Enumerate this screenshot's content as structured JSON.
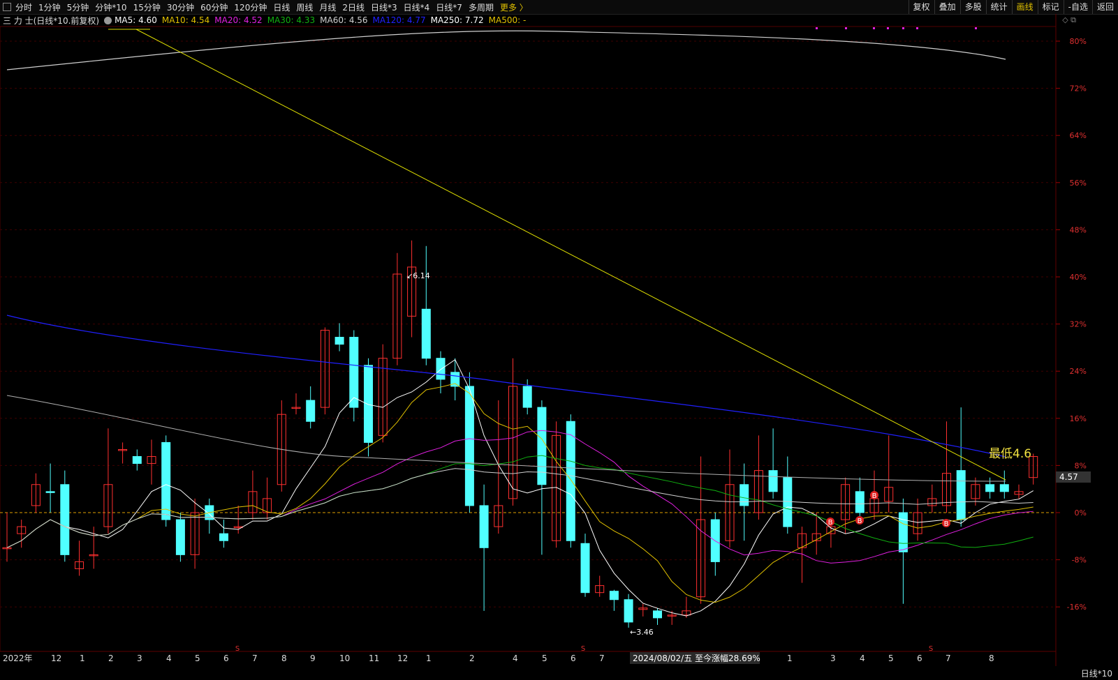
{
  "toolbar": {
    "periods": [
      "分时",
      "1分钟",
      "5分钟",
      "分钟*10",
      "15分钟",
      "30分钟",
      "60分钟",
      "120分钟",
      "日线",
      "周线",
      "月线",
      "2日线",
      "日线*3",
      "日线*4",
      "日线*7",
      "多周期"
    ],
    "more_label": "更多 〉",
    "right_tools": [
      "复权",
      "叠加",
      "多股",
      "统计",
      "画线",
      "标记",
      "-自选",
      "返回"
    ],
    "active_tool": "画线"
  },
  "legend": {
    "stock": "三 力 士(日线*10.前复权)",
    "ma": [
      {
        "label": "MA5: 4.60",
        "color": "#ffffff"
      },
      {
        "label": "MA10: 4.54",
        "color": "#e0c000"
      },
      {
        "label": "MA20: 4.52",
        "color": "#e020e0"
      },
      {
        "label": "MA30: 4.33",
        "color": "#10b010"
      },
      {
        "label": "MA60: 4.56",
        "color": "#d0d0d0"
      },
      {
        "label": "MA120: 4.77",
        "color": "#2020ff"
      },
      {
        "label": "MA250: 7.72",
        "color": "#ffffff"
      },
      {
        "label": "MA500: -",
        "color": "#e0c000"
      }
    ]
  },
  "chart_data": {
    "type": "candlestick",
    "pct_axis": {
      "ticks": [
        "80%",
        "72%",
        "64%",
        "56%",
        "48%",
        "40%",
        "32%",
        "24%",
        "16%",
        "8%",
        "0%",
        "-8%",
        "-16%"
      ]
    },
    "x_labels": [
      "2022年",
      "12",
      "1",
      "2",
      "3",
      "4",
      "5",
      "6",
      "7",
      "8",
      "9",
      "10",
      "11",
      "12",
      "1",
      "2",
      "4",
      "5",
      "6",
      "7",
      "8",
      "1",
      "3",
      "4",
      "5",
      "6",
      "7",
      "8"
    ],
    "candles": [
      [
        3.95,
        4.2,
        3.95,
        3.85,
        "up"
      ],
      [
        4.1,
        4.15,
        4.05,
        3.95,
        "up"
      ],
      [
        4.4,
        4.48,
        4.25,
        4.2,
        "up"
      ],
      [
        4.35,
        4.55,
        4.35,
        4.2,
        "dn"
      ],
      [
        4.4,
        4.5,
        3.9,
        3.85,
        "dn"
      ],
      [
        3.8,
        4.0,
        3.85,
        3.75,
        "up"
      ],
      [
        3.9,
        4.1,
        3.9,
        3.8,
        "up"
      ],
      [
        4.4,
        4.8,
        4.1,
        4.05,
        "up"
      ],
      [
        4.65,
        4.7,
        4.65,
        4.55,
        "up"
      ],
      [
        4.6,
        4.65,
        4.55,
        4.5,
        "dn"
      ],
      [
        4.6,
        4.72,
        4.55,
        4.4,
        "up"
      ],
      [
        4.7,
        4.75,
        4.15,
        4.1,
        "dn"
      ],
      [
        4.15,
        4.2,
        3.9,
        3.85,
        "dn"
      ],
      [
        3.9,
        4.3,
        4.2,
        3.8,
        "up"
      ],
      [
        4.25,
        4.3,
        4.15,
        4.05,
        "dn"
      ],
      [
        4.0,
        4.15,
        4.05,
        3.95,
        "dn"
      ],
      [
        4.1,
        4.25,
        4.1,
        4.05,
        "up"
      ],
      [
        4.35,
        4.5,
        4.2,
        4.15,
        "up"
      ],
      [
        4.3,
        4.45,
        4.2,
        4.15,
        "up"
      ],
      [
        4.9,
        5.0,
        4.4,
        4.35,
        "up"
      ],
      [
        4.95,
        5.05,
        4.95,
        4.9,
        "up"
      ],
      [
        5.0,
        5.1,
        4.85,
        4.8,
        "dn"
      ],
      [
        5.5,
        5.52,
        4.95,
        4.9,
        "up"
      ],
      [
        5.45,
        5.55,
        5.4,
        5.35,
        "dn"
      ],
      [
        5.45,
        5.5,
        4.95,
        4.85,
        "dn"
      ],
      [
        5.25,
        5.3,
        4.7,
        4.6,
        "dn"
      ],
      [
        5.3,
        5.4,
        4.75,
        4.7,
        "up"
      ],
      [
        5.9,
        6.05,
        5.3,
        5.25,
        "up"
      ],
      [
        5.95,
        6.14,
        5.6,
        5.45,
        "up"
      ],
      [
        5.65,
        6.1,
        5.3,
        5.25,
        "dn"
      ],
      [
        5.3,
        5.35,
        5.15,
        5.05,
        "dn"
      ],
      [
        5.2,
        5.3,
        5.1,
        5.0,
        "dn"
      ],
      [
        5.1,
        5.2,
        4.25,
        4.2,
        "dn"
      ],
      [
        4.25,
        4.4,
        3.95,
        3.5,
        "dn"
      ],
      [
        4.1,
        5.0,
        4.25,
        4.05,
        "up"
      ],
      [
        5.1,
        5.3,
        4.3,
        4.25,
        "up"
      ],
      [
        5.1,
        5.15,
        4.95,
        4.9,
        "dn"
      ],
      [
        4.95,
        5.0,
        4.4,
        3.9,
        "dn"
      ],
      [
        4.75,
        4.85,
        4.0,
        3.95,
        "up"
      ],
      [
        4.85,
        4.9,
        4.0,
        3.95,
        "dn"
      ],
      [
        3.98,
        4.05,
        3.63,
        3.6,
        "dn"
      ],
      [
        3.68,
        3.75,
        3.63,
        3.6,
        "up"
      ],
      [
        3.64,
        3.65,
        3.58,
        3.5,
        "dn"
      ],
      [
        3.58,
        3.62,
        3.42,
        3.38,
        "dn"
      ],
      [
        3.52,
        3.55,
        3.51,
        3.46,
        "up"
      ],
      [
        3.5,
        3.52,
        3.45,
        3.4,
        "dn"
      ],
      [
        3.47,
        3.5,
        3.47,
        3.4,
        "up"
      ],
      [
        3.5,
        3.6,
        3.47,
        3.45,
        "up"
      ],
      [
        4.15,
        4.6,
        3.6,
        3.55,
        "up"
      ],
      [
        4.15,
        4.2,
        3.85,
        3.75,
        "dn"
      ],
      [
        4.4,
        4.65,
        4.0,
        3.95,
        "up"
      ],
      [
        4.4,
        4.55,
        4.25,
        4.0,
        "dn"
      ],
      [
        4.2,
        4.75,
        4.5,
        4.15,
        "up"
      ],
      [
        4.5,
        4.8,
        4.35,
        4.3,
        "dn"
      ],
      [
        4.45,
        4.6,
        4.1,
        4.05,
        "dn"
      ],
      [
        4.05,
        4.1,
        3.95,
        3.7,
        "up"
      ],
      [
        4.05,
        4.2,
        4.0,
        3.9,
        "up"
      ],
      [
        4.1,
        4.15,
        4.05,
        3.95,
        "up"
      ],
      [
        4.4,
        4.45,
        4.15,
        4.05,
        "up"
      ],
      [
        4.35,
        4.45,
        4.2,
        4.15,
        "dn"
      ],
      [
        4.3,
        4.5,
        4.2,
        4.15,
        "up"
      ],
      [
        4.38,
        4.75,
        4.28,
        4.2,
        "up"
      ],
      [
        4.2,
        4.3,
        3.92,
        3.55,
        "dn"
      ],
      [
        4.2,
        4.3,
        4.05,
        4.0,
        "up"
      ],
      [
        4.3,
        4.4,
        4.25,
        4.2,
        "up"
      ],
      [
        4.48,
        4.85,
        4.25,
        4.2,
        "up"
      ],
      [
        4.5,
        4.95,
        4.15,
        4.1,
        "dn"
      ],
      [
        4.4,
        4.45,
        4.3,
        4.25,
        "up"
      ],
      [
        4.4,
        4.45,
        4.35,
        4.3,
        "dn"
      ],
      [
        4.4,
        4.5,
        4.35,
        4.3,
        "dn"
      ],
      [
        4.35,
        4.4,
        4.33,
        4.3,
        "up"
      ],
      [
        4.6,
        4.62,
        4.45,
        4.4,
        "up"
      ]
    ],
    "annotations": {
      "high": "6.14",
      "low": "3.46",
      "label_low": "最低4.6",
      "current_price": "4.57",
      "info": "2024/08/02/五  至今涨幅28.69%",
      "signals": [
        "B",
        "B",
        "B",
        "B"
      ],
      "s_markers": [
        "S",
        "S",
        "S"
      ]
    },
    "zero_price": 4.2,
    "scale_pct_per_price": 0.238
  },
  "bottom": {
    "period_label": "日线*10"
  },
  "colors": {
    "up": "#ff3030",
    "down": "#50ffff",
    "grid": "#400000"
  }
}
